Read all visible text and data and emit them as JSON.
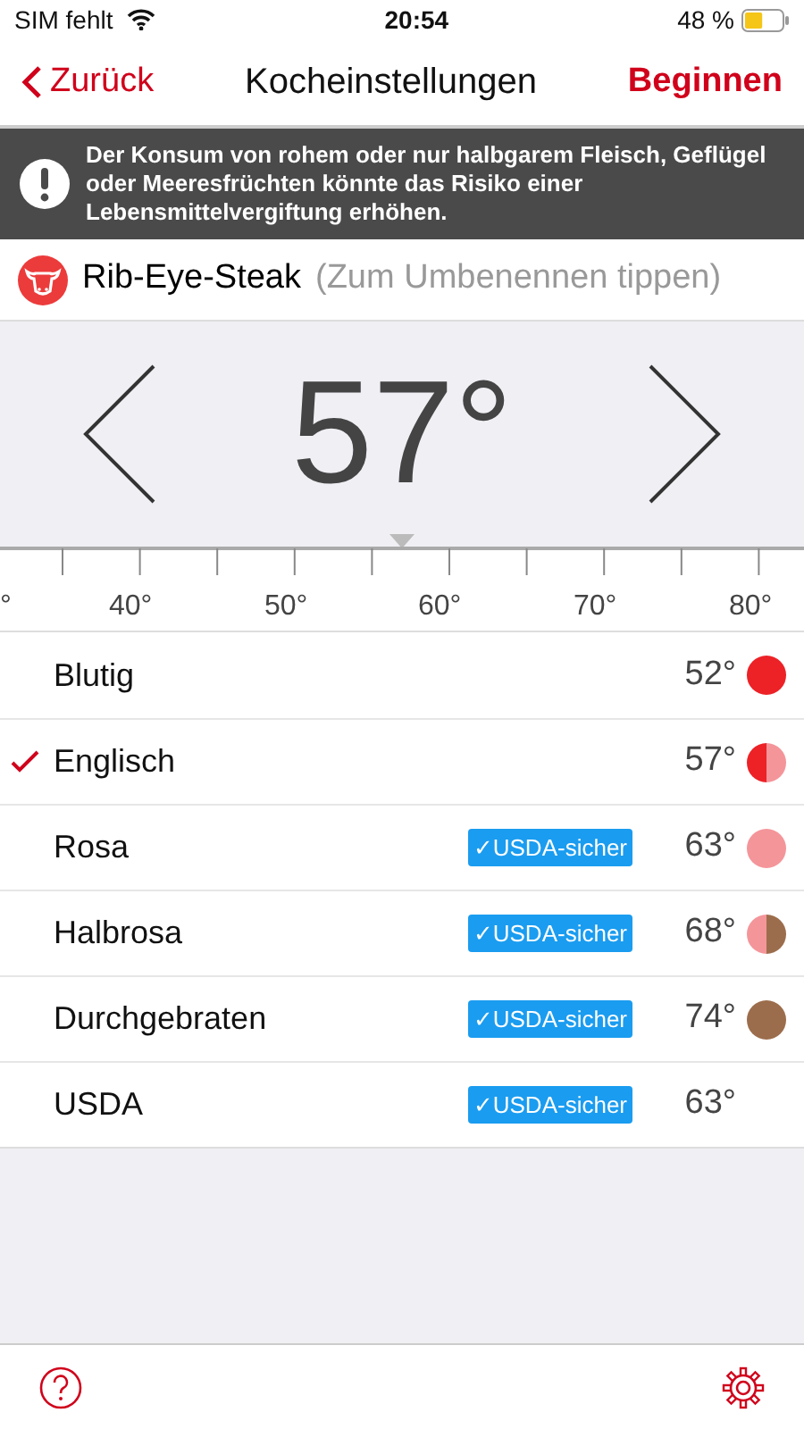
{
  "status_bar": {
    "carrier": "SIM fehlt",
    "time": "20:54",
    "battery": "48 %"
  },
  "nav": {
    "back": "Zurück",
    "title": "Kocheinstellungen",
    "action": "Beginnen"
  },
  "warning": "Der Konsum von rohem oder nur halbgarem Fleisch, Geflügel oder Meeresfrüchten könnte das Risiko einer Lebensmittelvergiftung erhöhen.",
  "meat": {
    "name": "Rib-Eye-Steak",
    "hint": "(Zum Umbenennen tippen)"
  },
  "picker": {
    "value": "57°"
  },
  "ruler": {
    "labels": [
      "°",
      "40°",
      "50°",
      "60°",
      "70°",
      "80°"
    ]
  },
  "doneness": [
    {
      "name": "Blutig",
      "temp": "52°",
      "selected": false,
      "dot": [
        {
          "color": "#ec2227"
        }
      ]
    },
    {
      "name": "Englisch",
      "temp": "57°",
      "selected": true,
      "dot": [
        {
          "color": "#ec2227"
        },
        {
          "color": "#f4959a"
        }
      ]
    },
    {
      "name": "Rosa",
      "temp": "63°",
      "selected": false,
      "badge": "✓USDA-sicher",
      "dot": [
        {
          "color": "#f4959a"
        }
      ]
    },
    {
      "name": "Halbrosa",
      "temp": "68°",
      "selected": false,
      "badge": "✓USDA-sicher",
      "dot": [
        {
          "color": "#f4959a"
        },
        {
          "color": "#9c6d4c"
        }
      ]
    },
    {
      "name": "Durchgebraten",
      "temp": "74°",
      "selected": false,
      "badge": "✓USDA-sicher",
      "dot": [
        {
          "color": "#9c6d4c"
        }
      ]
    },
    {
      "name": "USDA",
      "temp": "63°",
      "selected": false,
      "badge": "✓USDA-sicher"
    }
  ]
}
